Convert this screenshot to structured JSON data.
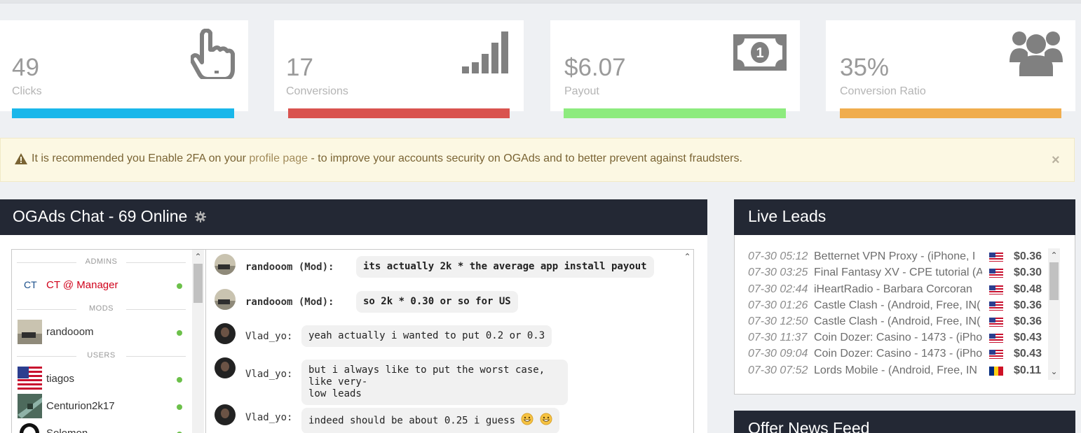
{
  "stats": [
    {
      "value": "49",
      "label": "Clicks",
      "icon": "pointer-hand-icon",
      "color": "#1ab7ea"
    },
    {
      "value": "17",
      "label": "Conversions",
      "icon": "signal-bars-icon",
      "color": "#d9534f"
    },
    {
      "value": "$6.07",
      "label": "Payout",
      "icon": "money-bill-icon",
      "color": "#8deb7e"
    },
    {
      "value": "35%",
      "label": "Conversion Ratio",
      "icon": "users-group-icon",
      "color": "#f0ad4e"
    }
  ],
  "alert": {
    "icon": "warning-triangle-icon",
    "text_before": "It is recommended you Enable 2FA on your ",
    "link_text": "profile page",
    "text_after": " - to improve your accounts security on OGAds and to better prevent against fraudsters.",
    "close": "×"
  },
  "chat": {
    "title": "OGAds Chat - 69 Online",
    "settings_icon": "gear-icon",
    "sections": {
      "admins": "ADMINS",
      "mods": "MODS",
      "users": "USERS"
    },
    "admins": [
      {
        "name": "CT @ Manager",
        "color": "#d0021b"
      }
    ],
    "mods": [
      {
        "name": "randooom"
      }
    ],
    "users": [
      {
        "name": "tiagos"
      },
      {
        "name": "Centurion2k17"
      },
      {
        "name": "Solomon"
      }
    ],
    "messages": [
      {
        "user": "randooom (Mod):",
        "text": "its actually 2k * the average app install payout",
        "mod": true
      },
      {
        "user": "randooom (Mod):",
        "text": "so 2k * 0.30 or so for US",
        "mod": true
      },
      {
        "user": "Vlad_yo:",
        "text": "yeah actually i wanted to put 0.2 or 0.3",
        "mod": false
      },
      {
        "user": "Vlad_yo:",
        "text_line1": "but i always like to put the worst case, like very-",
        "text_line2": "low leads",
        "mod": false
      },
      {
        "user": "Vlad_yo:",
        "text": "indeed should be about 0.25 i guess",
        "mod": false,
        "emojis": [
          "smile-emoji-icon",
          "smile-emoji-icon"
        ]
      }
    ]
  },
  "live_leads": {
    "title": "Live Leads",
    "rows": [
      {
        "time": "07-30 05:12",
        "offer": "Betternet VPN Proxy - (iPhone, I",
        "flag": "us",
        "payout": "$0.36"
      },
      {
        "time": "07-30 03:25",
        "offer": "Final Fantasy XV - CPE tutorial (A",
        "flag": "us",
        "payout": "$0.30"
      },
      {
        "time": "07-30 02:44",
        "offer": "iHeartRadio - Barbara Corcoran",
        "flag": "us",
        "payout": "$0.48"
      },
      {
        "time": "07-30 01:26",
        "offer": "Castle Clash - (Android, Free, IN(",
        "flag": "us",
        "payout": "$0.36"
      },
      {
        "time": "07-30 12:50",
        "offer": "Castle Clash - (Android, Free, IN(",
        "flag": "us",
        "payout": "$0.36"
      },
      {
        "time": "07-30 11:37",
        "offer": "Coin Dozer: Casino - 1473 - (iPho",
        "flag": "us",
        "payout": "$0.43"
      },
      {
        "time": "07-30 09:04",
        "offer": "Coin Dozer: Casino - 1473 - (iPho",
        "flag": "us",
        "payout": "$0.43"
      },
      {
        "time": "07-30 07:52",
        "offer": "Lords Mobile - (Android, Free, IN",
        "flag": "ro",
        "payout": "$0.11"
      }
    ]
  },
  "news": {
    "title": "Offer News Feed"
  }
}
